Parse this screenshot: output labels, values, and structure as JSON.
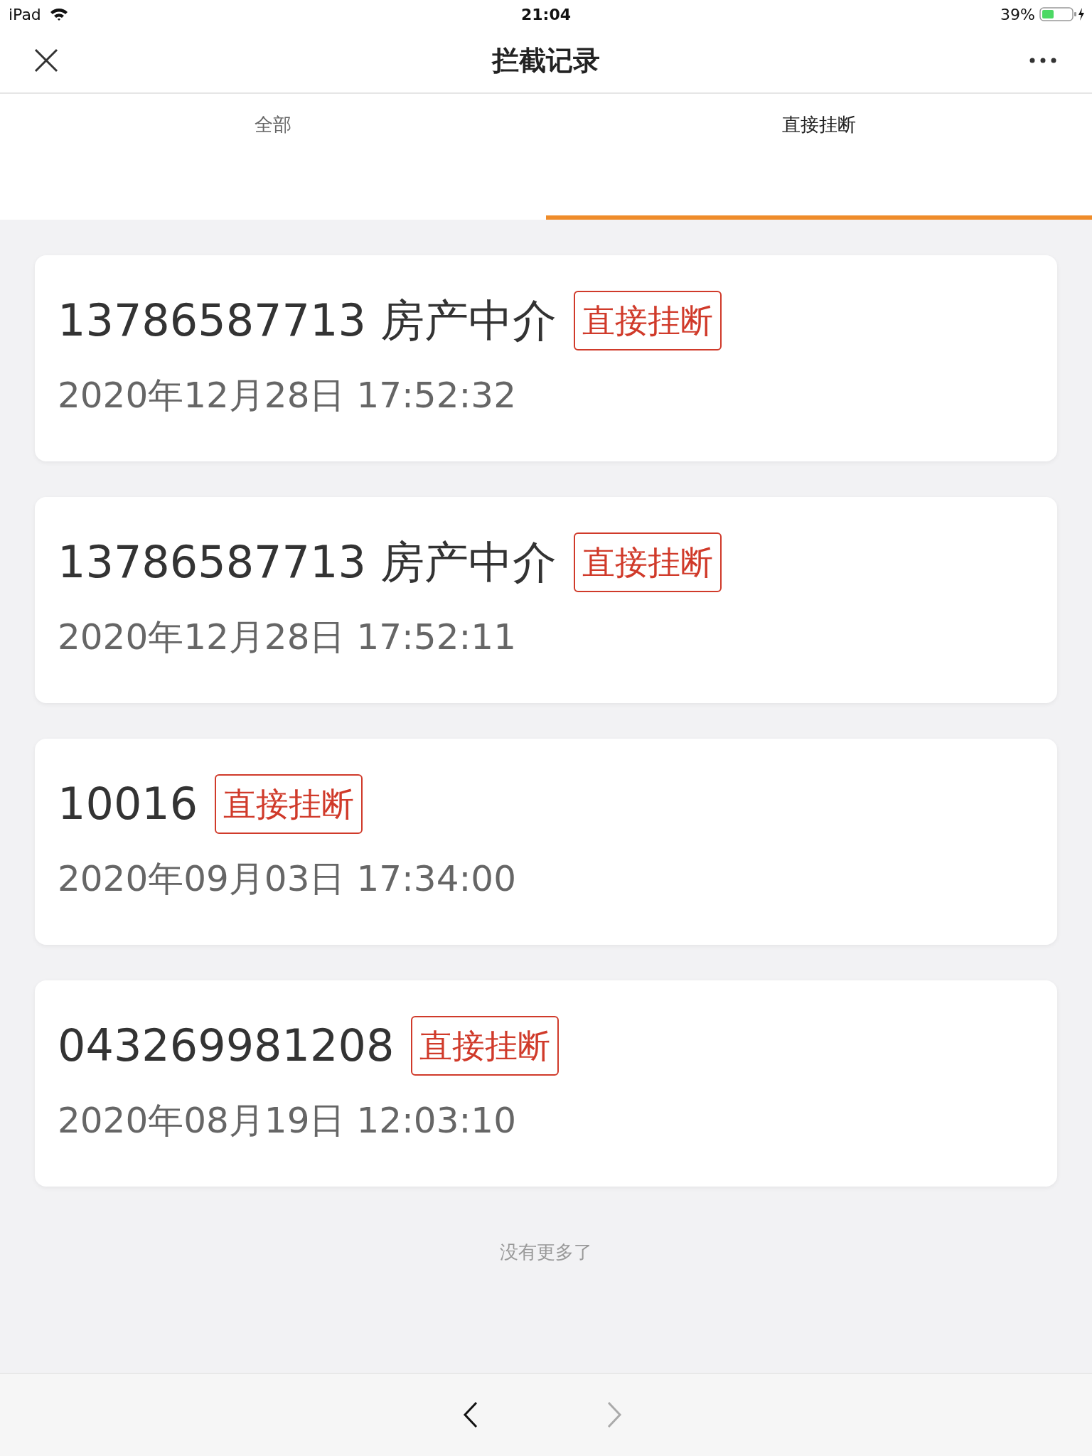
{
  "status_bar": {
    "device": "iPad",
    "time": "21:04",
    "battery": "39%"
  },
  "header": {
    "title": "拦截记录"
  },
  "tabs": [
    {
      "label": "全部",
      "selected": false
    },
    {
      "label": "直接挂断",
      "selected": true
    }
  ],
  "records": [
    {
      "caller": "13786587713 房产中介",
      "tag": "直接挂断",
      "time": "2020年12月28日 17:52:32"
    },
    {
      "caller": "13786587713 房产中介",
      "tag": "直接挂断",
      "time": "2020年12月28日 17:52:11"
    },
    {
      "caller": "10016",
      "tag": "直接挂断",
      "time": "2020年09月03日 17:34:00"
    },
    {
      "caller": "043269981208",
      "tag": "直接挂断",
      "time": "2020年08月19日 12:03:10"
    }
  ],
  "end_note": "没有更多了",
  "nav": {
    "back": {
      "disabled": false
    },
    "forward": {
      "disabled": true
    }
  }
}
